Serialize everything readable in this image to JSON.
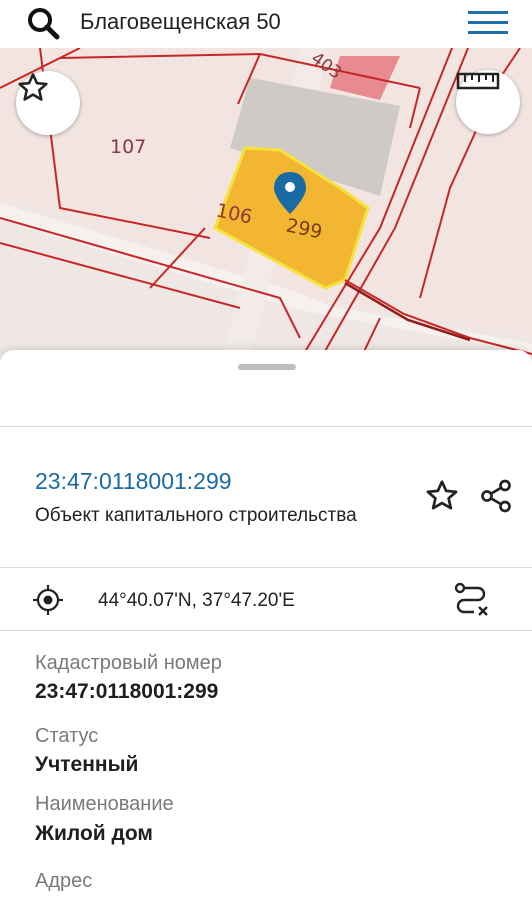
{
  "search": {
    "query": "Благовещенская 50"
  },
  "map": {
    "labels": {
      "parcel_107": "107",
      "parcel_106": "106",
      "parcel_299": "299",
      "parcel_403": "403"
    }
  },
  "object": {
    "cadastral_number": "23:47:0118001:299",
    "type": "Объект капитального строительства",
    "coordinates": "44°40.07'N, 37°47.20'E"
  },
  "fields": [
    {
      "label": "Кадастровый номер",
      "value": "23:47:0118001:299"
    },
    {
      "label": "Статус",
      "value": "Учтенный"
    },
    {
      "label": "Наименование",
      "value": "Жилой дом"
    },
    {
      "label": "Адрес",
      "value": ""
    }
  ],
  "colors": {
    "accent_blue": "#1a6aa4",
    "parcel_line": "#c62828",
    "highlight_fill": "#f2b632",
    "highlight_stroke": "#f6e33a",
    "map_background": "#f1e4e1",
    "menu_icon": "#1e6fa8"
  },
  "icons": {
    "search": "search-icon",
    "menu": "menu-icon",
    "favorite": "star-icon",
    "ruler": "ruler-icon",
    "pin": "map-pin-icon",
    "share": "share-icon",
    "locate": "crosshair-icon",
    "route": "route-icon"
  }
}
